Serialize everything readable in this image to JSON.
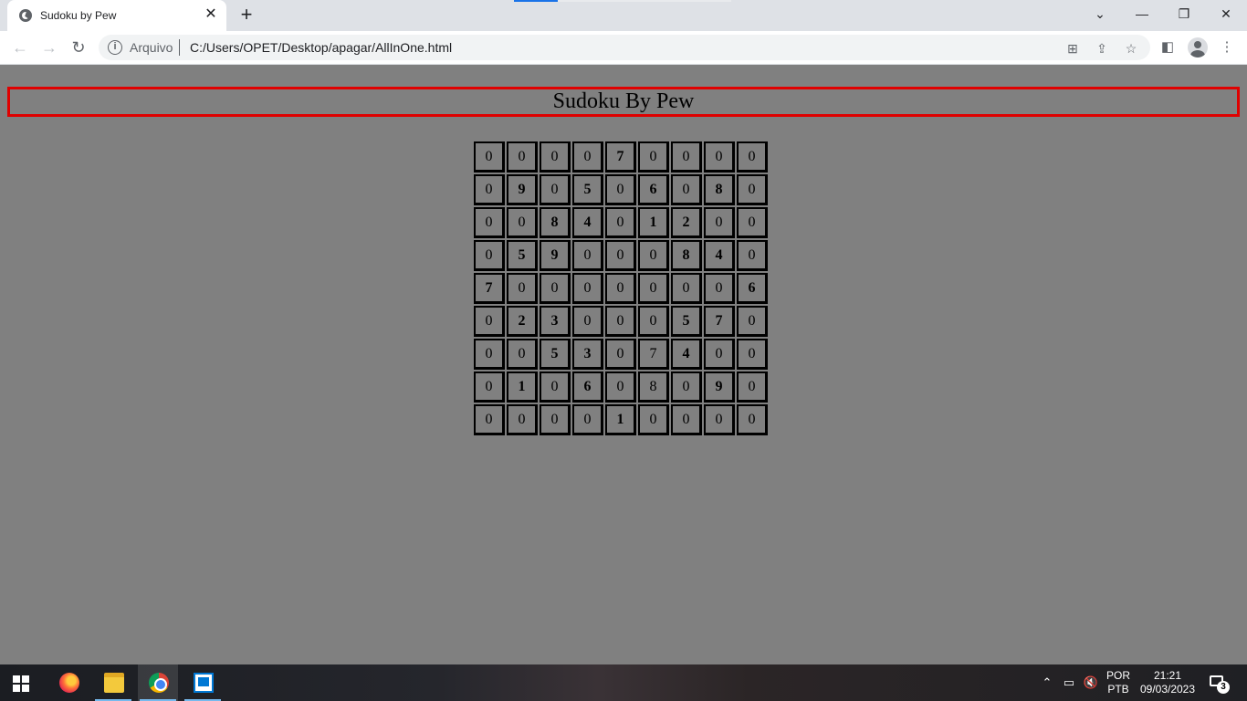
{
  "browser": {
    "tab_title": "Sudoku by Pew",
    "new_tab_symbol": "+",
    "close_symbol": "✕",
    "url_scheme_label": "Arquivo",
    "url": "C:/Users/OPET/Desktop/apagar/AllInOne.html"
  },
  "page": {
    "heading": "Sudoku By Pew",
    "header_border_color": "#e00000",
    "background_color": "#808080"
  },
  "sudoku": {
    "rows": [
      [
        0,
        0,
        0,
        0,
        7,
        0,
        0,
        0,
        0
      ],
      [
        0,
        9,
        0,
        5,
        0,
        6,
        0,
        8,
        0
      ],
      [
        0,
        0,
        8,
        4,
        0,
        1,
        2,
        0,
        0
      ],
      [
        0,
        5,
        9,
        0,
        0,
        0,
        8,
        4,
        0
      ],
      [
        7,
        0,
        0,
        0,
        0,
        0,
        0,
        0,
        6
      ],
      [
        0,
        2,
        3,
        0,
        0,
        0,
        5,
        7,
        0
      ],
      [
        0,
        0,
        5,
        3,
        0,
        7,
        4,
        0,
        0
      ],
      [
        0,
        1,
        0,
        6,
        0,
        8,
        0,
        9,
        0
      ],
      [
        0,
        0,
        0,
        0,
        1,
        0,
        0,
        0,
        0
      ]
    ],
    "bold": [
      [
        0,
        0,
        0,
        0,
        1,
        0,
        0,
        0,
        0
      ],
      [
        0,
        1,
        0,
        1,
        0,
        1,
        0,
        1,
        0
      ],
      [
        0,
        0,
        1,
        1,
        0,
        1,
        1,
        0,
        0
      ],
      [
        0,
        1,
        1,
        0,
        0,
        0,
        1,
        1,
        0
      ],
      [
        1,
        0,
        0,
        0,
        0,
        0,
        0,
        0,
        1
      ],
      [
        0,
        1,
        1,
        0,
        0,
        0,
        1,
        1,
        0
      ],
      [
        0,
        0,
        1,
        1,
        0,
        0,
        1,
        0,
        0
      ],
      [
        0,
        1,
        0,
        1,
        0,
        0,
        0,
        1,
        0
      ],
      [
        0,
        0,
        0,
        0,
        1,
        0,
        0,
        0,
        0
      ]
    ]
  },
  "taskbar": {
    "apps": [
      "firefox-icon",
      "file-explorer-icon",
      "chrome-icon",
      "remote-desktop-icon"
    ],
    "lang_top": "POR",
    "lang_bottom": "PTB",
    "time": "21:21",
    "date": "09/03/2023",
    "notification_count": "3"
  }
}
